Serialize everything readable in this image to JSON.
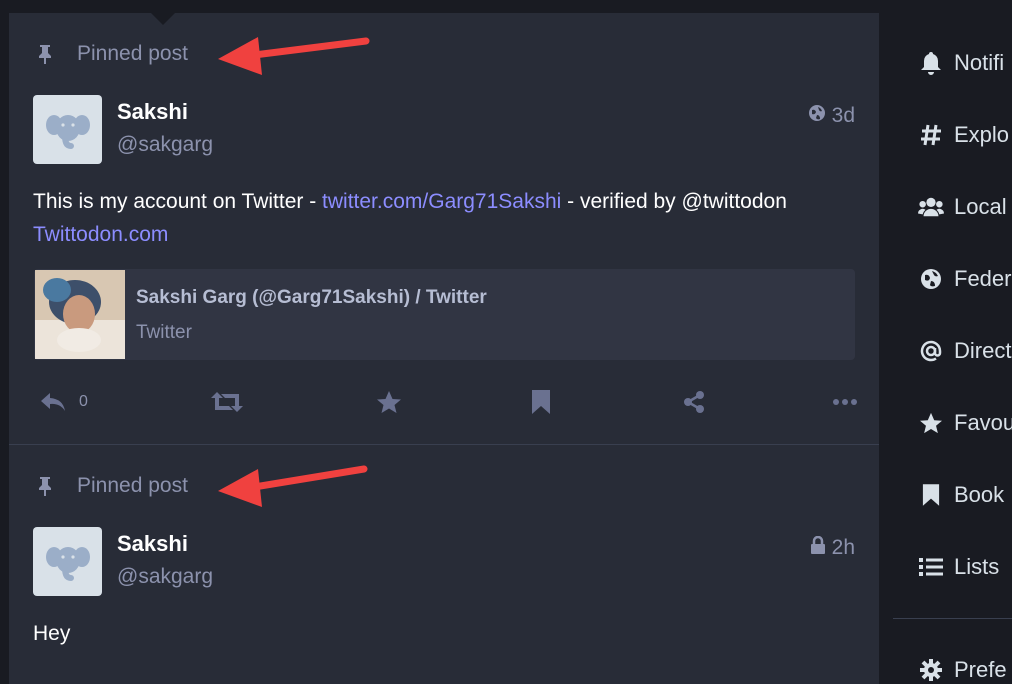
{
  "posts": [
    {
      "pinned_label": "Pinned post",
      "author_name": "Sakshi",
      "author_handle": "@sakgarg",
      "visibility_icon": "globe-icon",
      "time": "3d",
      "content_text_1": "This is my account on Twitter - ",
      "content_link_1": "twitter.com/Garg71Sakshi",
      "content_text_2": " - verified by @twittodon",
      "content_link_2": "Twittodon.com",
      "card": {
        "title": "Sakshi Garg (@Garg71Sakshi) / Twitter",
        "provider": "Twitter"
      },
      "reply_count": "0"
    },
    {
      "pinned_label": "Pinned post",
      "author_name": "Sakshi",
      "author_handle": "@sakgarg",
      "visibility_icon": "lock-icon",
      "time": "2h",
      "content_text": "Hey"
    }
  ],
  "sidebar": {
    "items": [
      {
        "label": "Notifi",
        "icon": "bell-icon"
      },
      {
        "label": "Explo",
        "icon": "hashtag-icon"
      },
      {
        "label": "Local",
        "icon": "users-icon"
      },
      {
        "label": "Feder",
        "icon": "globe-icon"
      },
      {
        "label": "Direct",
        "icon": "at-icon"
      },
      {
        "label": "Favou",
        "icon": "star-icon"
      },
      {
        "label": "Book",
        "icon": "bookmark-icon"
      },
      {
        "label": "Lists",
        "icon": "list-icon"
      },
      {
        "label": "Prefe",
        "icon": "gear-icon"
      }
    ]
  },
  "colors": {
    "background": "#191b22",
    "column": "#282c37",
    "link": "#8c8dff",
    "muted": "#8c92ad",
    "annotation_arrow": "#f0413f"
  }
}
